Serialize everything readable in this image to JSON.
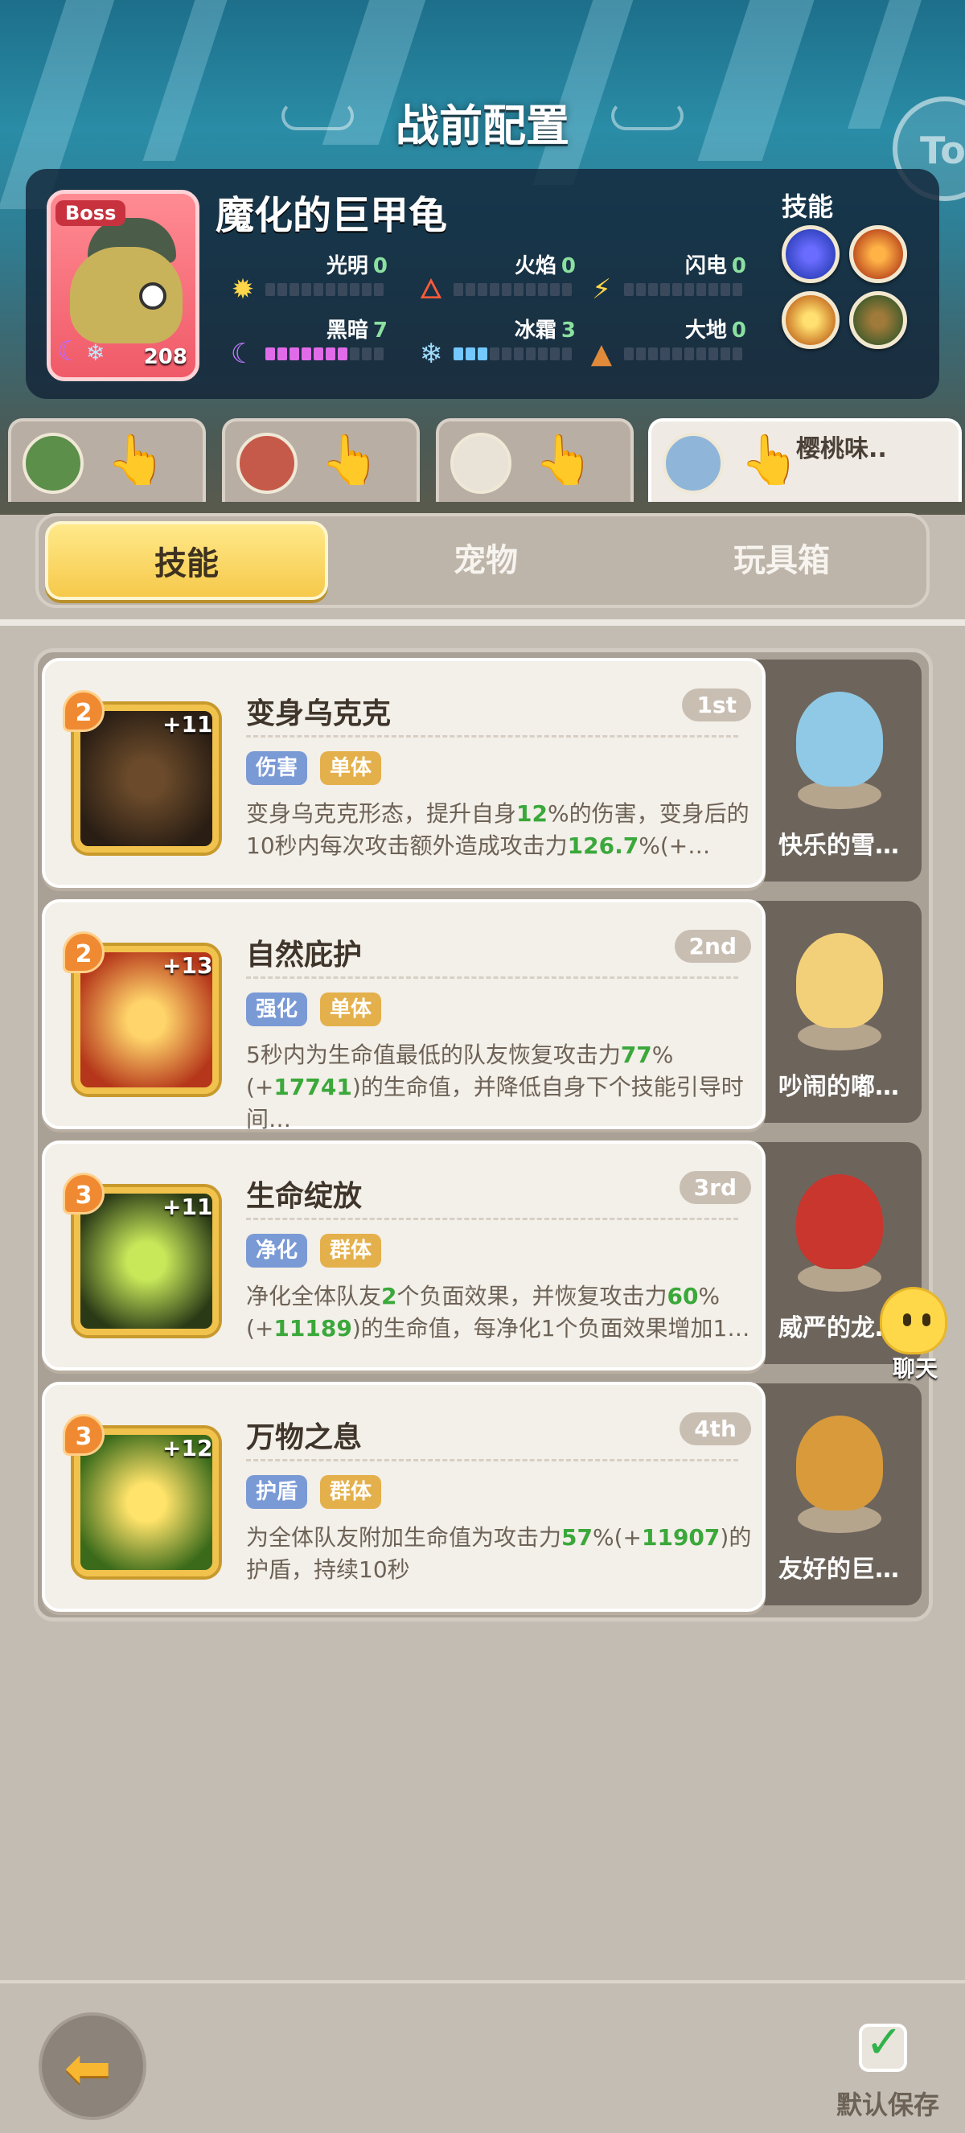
{
  "header": {
    "title": "战前配置",
    "side_badge": "To"
  },
  "boss": {
    "tag": "Boss",
    "name": "魔化的巨甲龟",
    "level": "208",
    "elements": [
      {
        "name": "光明",
        "value": "0",
        "icon": "sun-icon",
        "bar_filled": 0
      },
      {
        "name": "火焰",
        "value": "0",
        "icon": "fire-icon",
        "bar_filled": 0
      },
      {
        "name": "闪电",
        "value": "0",
        "icon": "lightning-icon",
        "bar_filled": 0
      },
      {
        "name": "黑暗",
        "value": "7",
        "icon": "moon-icon",
        "bar_filled": 7
      },
      {
        "name": "冰霜",
        "value": "3",
        "icon": "snowflake-icon",
        "bar_filled": 3
      },
      {
        "name": "大地",
        "value": "0",
        "icon": "earth-icon",
        "bar_filled": 0
      }
    ],
    "skills_title": "技能",
    "skill_orbs": [
      "swirl-skill-icon",
      "fire-skill-icon",
      "crown-skill-icon",
      "beast-skill-icon"
    ]
  },
  "team_tabs": [
    {
      "avatar": "green-hero-avatar",
      "name": ""
    },
    {
      "avatar": "red-hero-avatar",
      "name": ""
    },
    {
      "avatar": "white-hero-avatar",
      "name": ""
    },
    {
      "avatar": "blue-hero-avatar",
      "name": "樱桃味.."
    }
  ],
  "tabs": [
    "技能",
    "宠物",
    "玩具箱"
  ],
  "skills": [
    {
      "level": "2",
      "plus": "+11",
      "title": "变身乌克克",
      "rank": "1st",
      "tags": [
        "伤害",
        "单体"
      ],
      "desc_parts": [
        "变身乌克克形态，提升自身",
        "12",
        "%的伤害，变身后的10秒内每次攻击额外造成攻击力",
        "126.7",
        "%(+…"
      ],
      "pet": "快乐的雪…"
    },
    {
      "level": "2",
      "plus": "+13",
      "title": "自然庇护",
      "rank": "2nd",
      "tags": [
        "强化",
        "单体"
      ],
      "desc_parts": [
        "5秒内为生命值最低的队友恢复攻击力",
        "77",
        "%(+",
        "17741",
        ")的生命值，并降低自身下个技能引导时间…"
      ],
      "pet": "吵闹的嘟…"
    },
    {
      "level": "3",
      "plus": "+11",
      "title": "生命绽放",
      "rank": "3rd",
      "tags": [
        "净化",
        "群体"
      ],
      "desc_parts": [
        "净化全体队友",
        "2",
        "个负面效果，并恢复攻击力",
        "60",
        "%(+",
        "11189",
        ")的生命值，每净化1个负面效果增加1…"
      ],
      "pet": "威严的龙…"
    },
    {
      "level": "3",
      "plus": "+12",
      "title": "万物之息",
      "rank": "4th",
      "tags": [
        "护盾",
        "群体"
      ],
      "desc_parts": [
        "为全体队友附加生命值为攻击力",
        "57",
        "%(+",
        "11907",
        ")的护盾，持续10秒"
      ],
      "pet": "友好的巨…"
    }
  ],
  "chat": {
    "label": "聊天"
  },
  "bottom": {
    "save_label": "默认保存"
  },
  "colors": {
    "accent": "#f6c94a",
    "green_value": "#3aa83a",
    "blue_tag": "#7a9ad6",
    "gold_tag": "#e4b04b"
  }
}
